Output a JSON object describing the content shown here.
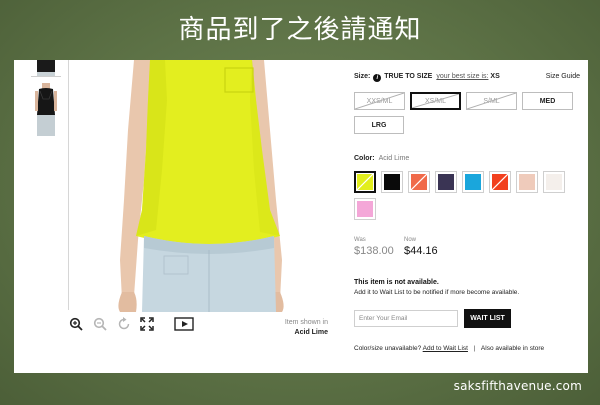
{
  "slide": {
    "title": "商品到了之後請通知",
    "watermark": "saksfifthavenue.com"
  },
  "viewer": {
    "item_shown_label": "Item shown in",
    "item_shown_color": "Acid Lime",
    "tools": [
      "zoom-in-icon",
      "zoom-out-icon",
      "rotate-icon",
      "fullscreen-icon",
      "video-play-icon"
    ]
  },
  "size": {
    "label": "Size:",
    "true_to_size": "TRUE TO SIZE",
    "best_size_hint": "your best size is:",
    "best_size": "XS",
    "guide_label": "Size Guide",
    "options": [
      {
        "label": "XXS/ML",
        "available": false,
        "selected": false
      },
      {
        "label": "XS/ML",
        "available": false,
        "selected": true
      },
      {
        "label": "S/ML",
        "available": false,
        "selected": false
      },
      {
        "label": "MED",
        "available": true,
        "selected": false
      },
      {
        "label": "LRG",
        "available": true,
        "selected": false
      }
    ]
  },
  "color": {
    "label": "Color:",
    "selected_name": "Acid Lime",
    "swatches": [
      {
        "hex": "#e2ee1c",
        "selected": true,
        "available": false
      },
      {
        "hex": "#0a0a0a",
        "selected": false,
        "available": true
      },
      {
        "hex": "#f06a4a",
        "selected": false,
        "available": false
      },
      {
        "hex": "#3a3454",
        "selected": false,
        "available": true
      },
      {
        "hex": "#1aa6dc",
        "selected": false,
        "available": true
      },
      {
        "hex": "#f2401e",
        "selected": false,
        "available": false
      },
      {
        "hex": "#efcbbb",
        "selected": false,
        "available": true
      },
      {
        "hex": "#f4efeb",
        "selected": false,
        "available": true
      },
      {
        "hex": "#f4a7d8",
        "selected": false,
        "available": true
      }
    ]
  },
  "price": {
    "was_label": "Was",
    "was": "$138.00",
    "now_label": "Now",
    "now": "$44.16"
  },
  "availability": {
    "title": "This item is not available.",
    "message": "Add it to Wait List to be notified if more become available."
  },
  "wait_list": {
    "email_placeholder": "Enter Your Email",
    "button_label": "WAIT LIST"
  },
  "footer_line": {
    "prefix": "Color/size unavailable?",
    "add_link": "Add to Wait List",
    "separator": "|",
    "store_text": "Also available in store"
  }
}
